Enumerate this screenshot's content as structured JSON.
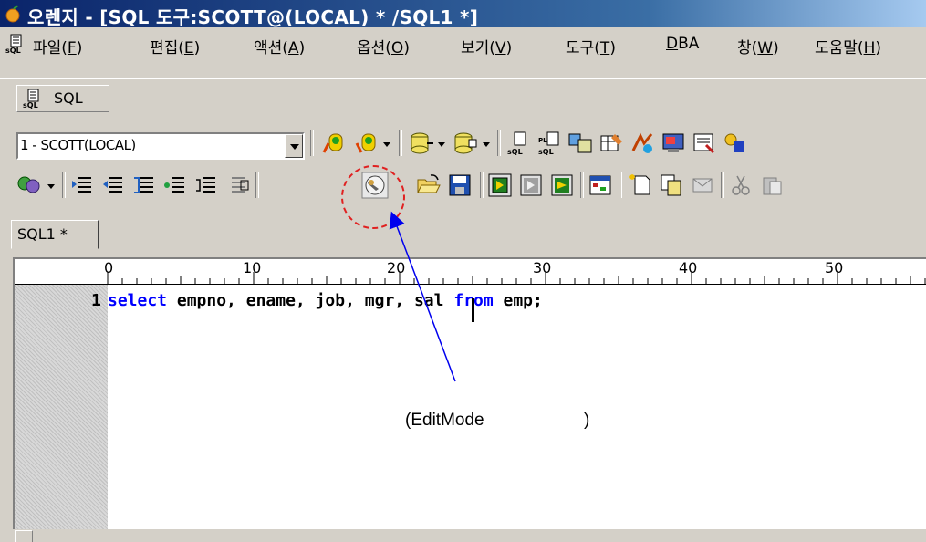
{
  "window": {
    "title": "오렌지 - [SQL 도구:SCOTT@(LOCAL) * /SQL1 *]"
  },
  "menu": [
    {
      "label": "파일(",
      "mn": "F",
      "tail": ")"
    },
    {
      "label": "편집(",
      "mn": "E",
      "tail": ")"
    },
    {
      "label": "액션(",
      "mn": "A",
      "tail": ")"
    },
    {
      "label": "옵션(",
      "mn": "O",
      "tail": ")"
    },
    {
      "label": "보기(",
      "mn": "V",
      "tail": ")"
    },
    {
      "label": "도구(",
      "mn": "T",
      "tail": ")"
    },
    {
      "label": "",
      "mn": "D",
      "tail": "BA"
    },
    {
      "label": "창(",
      "mn": "W",
      "tail": ")"
    },
    {
      "label": "도움말(",
      "mn": "H",
      "tail": ")"
    }
  ],
  "sql_tab_button": {
    "label": "SQL",
    "icon": "sql-document-icon"
  },
  "connection_combo": {
    "value": "1 - SCOTT(LOCAL)"
  },
  "editor_tab": {
    "label": "SQL1 *"
  },
  "ruler": {
    "marks": [
      "0",
      "10",
      "20",
      "30",
      "40",
      "50"
    ]
  },
  "editor": {
    "line_number": "1",
    "code_tokens": [
      {
        "text": "select",
        "kw": true
      },
      {
        "text": " empno, ename, job, mgr, sal ",
        "kw": false
      },
      {
        "text": "from",
        "kw": true
      },
      {
        "text": " emp;",
        "kw": false
      }
    ]
  },
  "annotation": {
    "text": "(EditMode",
    "close": ")"
  },
  "colors": {
    "keyword": "#0000ff",
    "annotation_circle": "#e02020",
    "annotation_arrow": "#0000ee",
    "title_bar": "#0a246a"
  }
}
